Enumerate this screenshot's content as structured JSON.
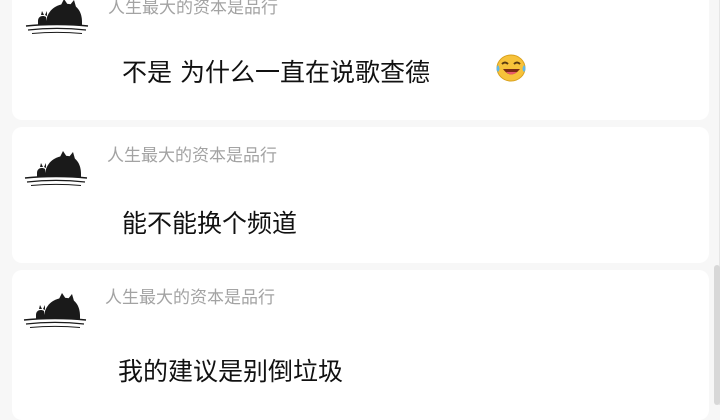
{
  "comments": [
    {
      "username": "人生最大的资本是品行",
      "message": "不是 为什么一直在说歌查德",
      "emoji": "laughing-crying-emoji",
      "avatar": "cat-avatar"
    },
    {
      "username": "人生最大的资本是品行",
      "message": "能不能换个频道",
      "avatar": "cat-avatar"
    },
    {
      "username": "人生最大的资本是品行",
      "message": "我的建议是别倒垃圾",
      "avatar": "cat-avatar"
    }
  ],
  "colors": {
    "background": "#f7f7f7",
    "card": "#ffffff",
    "username": "#a3a3a3",
    "message": "#111111"
  }
}
